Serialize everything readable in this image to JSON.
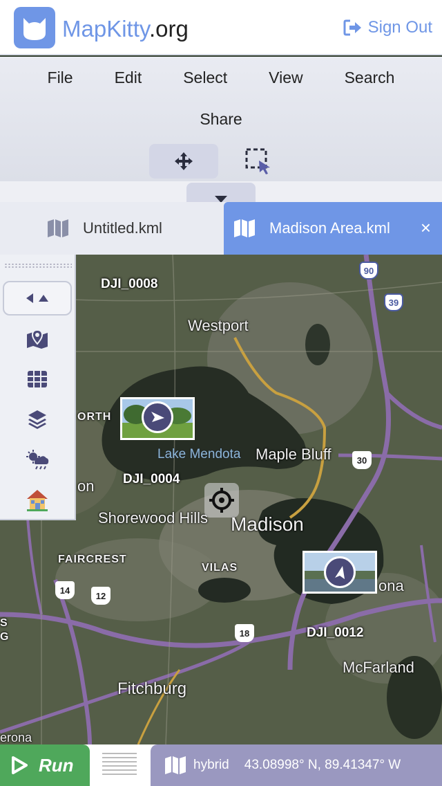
{
  "header": {
    "brand_part1": "MapKitty",
    "brand_part2": ".org",
    "signout_label": "Sign Out"
  },
  "menu": {
    "row1": [
      "File",
      "Edit",
      "Select",
      "View",
      "Search"
    ],
    "row2": [
      "Share"
    ]
  },
  "tabs": [
    {
      "label": "Untitled.kml",
      "active": false
    },
    {
      "label": "Madison Area.kml",
      "active": true
    }
  ],
  "tab_close": "×",
  "map": {
    "places": {
      "westport": "Westport",
      "north": "ORTH",
      "lake_mendota": "Lake Mendota",
      "maple_bluff": "Maple Bluff",
      "on": "on",
      "shorewood_hills": "Shorewood Hills",
      "madison": "Madison",
      "faircrest": "FAIRCREST",
      "vilas": "VILAS",
      "ona": "ona",
      "mcfarland": "McFarland",
      "fitchburg": "Fitchburg",
      "s": "S",
      "g": "G",
      "erona": "erona"
    },
    "drones": {
      "dji_0008": "DJI_0008",
      "dji_0004": "DJI_0004",
      "dji_0012": "DJI_0012"
    },
    "shields": {
      "i90": "90",
      "i39": "39",
      "r30": "30",
      "r14": "14",
      "r12": "12",
      "r18": "18"
    }
  },
  "side_panel": {
    "icons": [
      "map-icon",
      "table-icon",
      "layers-icon",
      "weather-icon",
      "house-icon"
    ]
  },
  "footer": {
    "run_label": "Run",
    "layer_label": "hybrid",
    "coordinates": "43.08998° N,  89.41347° W"
  },
  "colors": {
    "accent": "#6f96e6",
    "run": "#4fa85b",
    "status_bar": "#9a98c0"
  }
}
